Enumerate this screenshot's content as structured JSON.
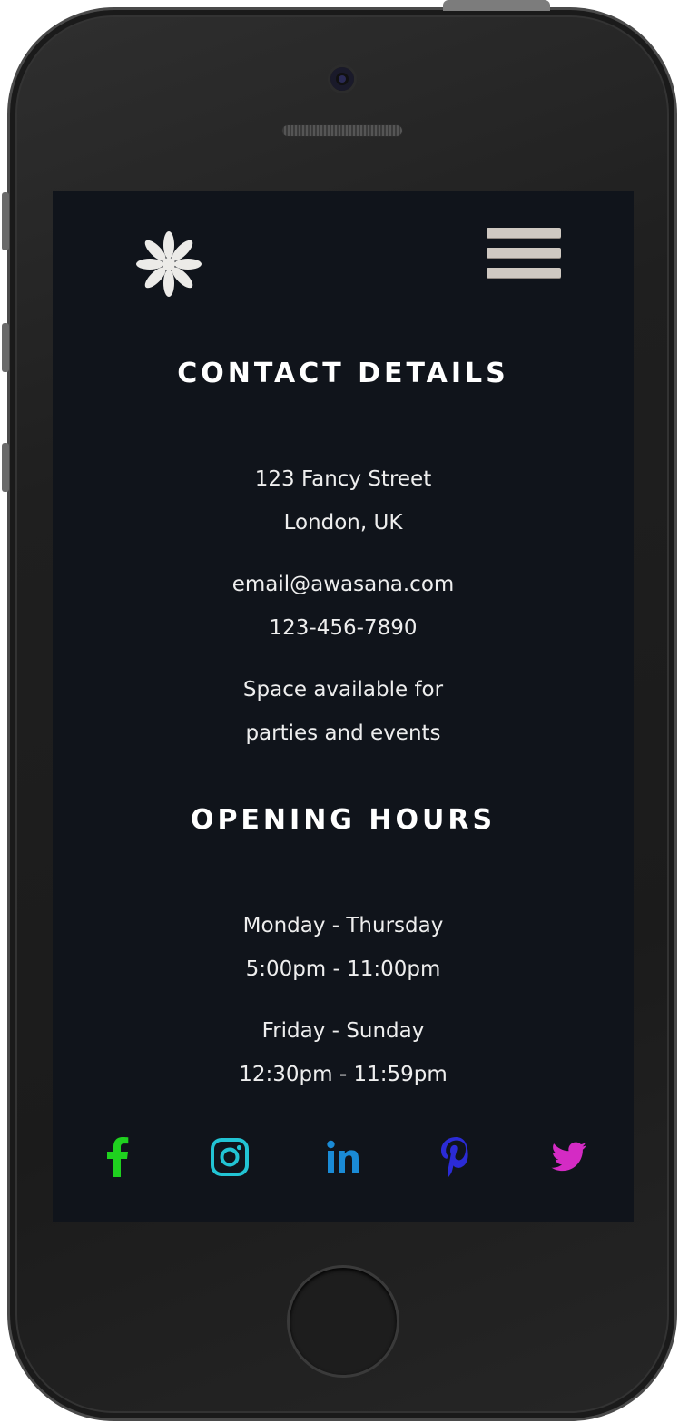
{
  "contact": {
    "heading": "CONTACT DETAILS",
    "address_line1": "123 Fancy Street",
    "address_line2": "London, UK",
    "email": "email@awasana.com",
    "phone": "123-456-7890",
    "note_line1": "Space available for",
    "note_line2": "parties and events"
  },
  "hours": {
    "heading": "OPENING HOURS",
    "group1_days": "Monday - Thursday",
    "group1_times": "5:00pm - 11:00pm",
    "group2_days": "Friday - Sunday",
    "group2_times": "12:30pm - 11:59pm"
  },
  "header": {
    "logo_icon": "asterisk-flower-icon",
    "menu_icon": "hamburger-menu-icon"
  },
  "social": [
    {
      "icon": "facebook-icon",
      "color": "#1fd11f"
    },
    {
      "icon": "instagram-icon",
      "color": "#22c4d4"
    },
    {
      "icon": "linkedin-icon",
      "color": "#1a8bd6"
    },
    {
      "icon": "pinterest-icon",
      "color": "#2b2bd6"
    },
    {
      "icon": "twitter-icon",
      "color": "#d42bc4"
    }
  ],
  "colors": {
    "screen_background": "#10141b",
    "text": "#eeeeee",
    "heading": "#ffffff"
  }
}
